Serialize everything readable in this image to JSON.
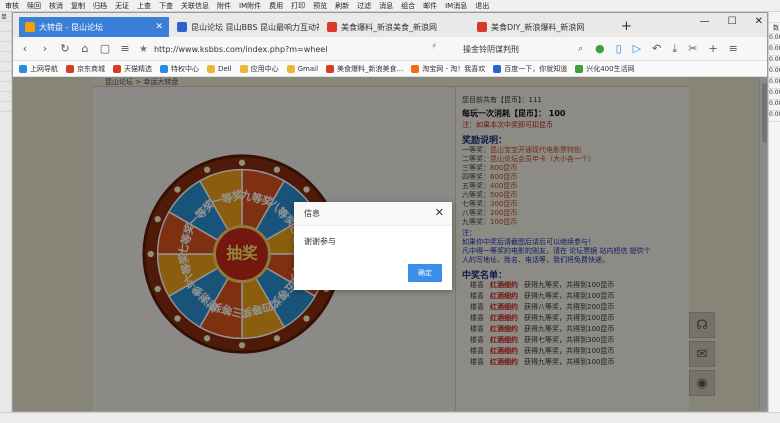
{
  "top_menu": [
    "审核",
    "赎回",
    "核消",
    "复制",
    "归档",
    "无证",
    "上查",
    "下查",
    "关联信息",
    "附件",
    "IM附件",
    "费用",
    "打印",
    "预览",
    "刷新",
    "过滤",
    "消息",
    "组合",
    "邮件",
    "IM消息",
    "退出"
  ],
  "tabs": [
    {
      "label": "大转盘 - 昆山论坛",
      "active": true,
      "color": "#f2a100"
    },
    {
      "label": "昆山论坛 昆山BBS 昆山最响力互动社区",
      "active": false,
      "color": "#2a64c8"
    },
    {
      "label": "美食爆料_新浪美食_新浪网",
      "active": false,
      "color": "#d83a2a"
    },
    {
      "label": "美食DIY_新浪爆料_新浪网",
      "active": false,
      "color": "#d83a2a"
    }
  ],
  "window_controls": [
    "—",
    "☐",
    "✕"
  ],
  "url": "http://www.ksbbs.com/index.php?m=wheel",
  "search_placeholder": "操金铃阴谋判刑",
  "bookmarks": [
    {
      "label": "上网导航",
      "color": "#2a8be0"
    },
    {
      "label": "京东商城",
      "color": "#d83a2a"
    },
    {
      "label": "天猫精选",
      "color": "#d83a2a"
    },
    {
      "label": "特权中心",
      "color": "#2a8be0"
    },
    {
      "label": "Dell",
      "color": "#e6b93a"
    },
    {
      "label": "应用中心",
      "color": "#e6b93a"
    },
    {
      "label": "Gmail",
      "color": "#e6b93a"
    },
    {
      "label": "美食爆料_新浪美食...",
      "color": "#d83a2a"
    },
    {
      "label": "淘宝网 - 淘！我喜欢",
      "color": "#f26a1b"
    },
    {
      "label": "百度一下，你就知道",
      "color": "#2a64c8"
    },
    {
      "label": "兴化400生活网",
      "color": "#3aa03a"
    }
  ],
  "breadcrumb": "昆山论坛 > 幸运大转盘",
  "wheel_segments": [
    "九等奖",
    "八等奖",
    "七等奖",
    "六等奖",
    "五等奖",
    "四等奖",
    "三等奖",
    "谢谢参与",
    "六等奖",
    "七等奖",
    "一等奖",
    "一等奖"
  ],
  "wheel_center": "抽奖",
  "info": {
    "balance_label": "您目前共有【昆币】：111",
    "cost": "每玩一次消耗【昆币】： 100",
    "note": "注：如果本次中奖即可扣昆币",
    "prize_title": "奖励说明：",
    "prizes": [
      {
        "level": "一等奖：",
        "desc": "昆山宝宝开通现代电影票特别"
      },
      {
        "level": "二等奖：",
        "desc": "昆山论坛会员年卡（大小各一个）"
      },
      {
        "level": "三等奖：",
        "desc": "800昆币"
      },
      {
        "level": "四等奖：",
        "desc": "600昆币"
      },
      {
        "level": "五等奖：",
        "desc": "400昆币"
      },
      {
        "level": "六等奖：",
        "desc": "500昆币"
      },
      {
        "level": "七等奖：",
        "desc": "300昆币"
      },
      {
        "level": "八等奖：",
        "desc": "200昆币"
      },
      {
        "level": "九等奖：",
        "desc": "100昆币"
      }
    ],
    "notes_title": "注：",
    "notes": [
      "如果你中奖后请截图后请后可以继续参与！",
      "凡中得一等奖的电影的则友，请在 论坛票据 站内短信 提供个",
      "人的写地址、姓名、电话等，我们将免费快递。"
    ],
    "winners_title": "中奖名单：",
    "winners": [
      {
        "who": "楼喜",
        "tag": "红酒细约",
        "res": "获得九等奖，共得到100昆币"
      },
      {
        "who": "楼喜",
        "tag": "红酒细约",
        "res": "获得九等奖，共得到100昆币"
      },
      {
        "who": "楼喜",
        "tag": "红酒细约",
        "res": "获得八等奖，共得到200昆币"
      },
      {
        "who": "楼喜",
        "tag": "红酒细约",
        "res": "获得九等奖，共得到100昆币"
      },
      {
        "who": "楼喜",
        "tag": "红酒细约",
        "res": "获得九等奖，共得到100昆币"
      },
      {
        "who": "楼喜",
        "tag": "红酒细约",
        "res": "获得七等奖，共得到300昆币"
      },
      {
        "who": "楼喜",
        "tag": "红酒细约",
        "res": "获得九等奖，共得到100昆币"
      },
      {
        "who": "楼喜",
        "tag": "红酒细约",
        "res": "获得九等奖，共得到100昆币"
      }
    ]
  },
  "dialog": {
    "title": "信息",
    "message": "谢谢参与",
    "ok_label": "确定"
  },
  "left_strip": [
    "单号",
    "",
    "",
    "",
    "",
    "",
    "",
    "",
    "",
    ""
  ],
  "right_strip": [
    "",
    "数",
    "0.00",
    "0.00",
    "0.00",
    "0.00",
    "0.00",
    "0.00",
    "0.00",
    "0.00"
  ]
}
